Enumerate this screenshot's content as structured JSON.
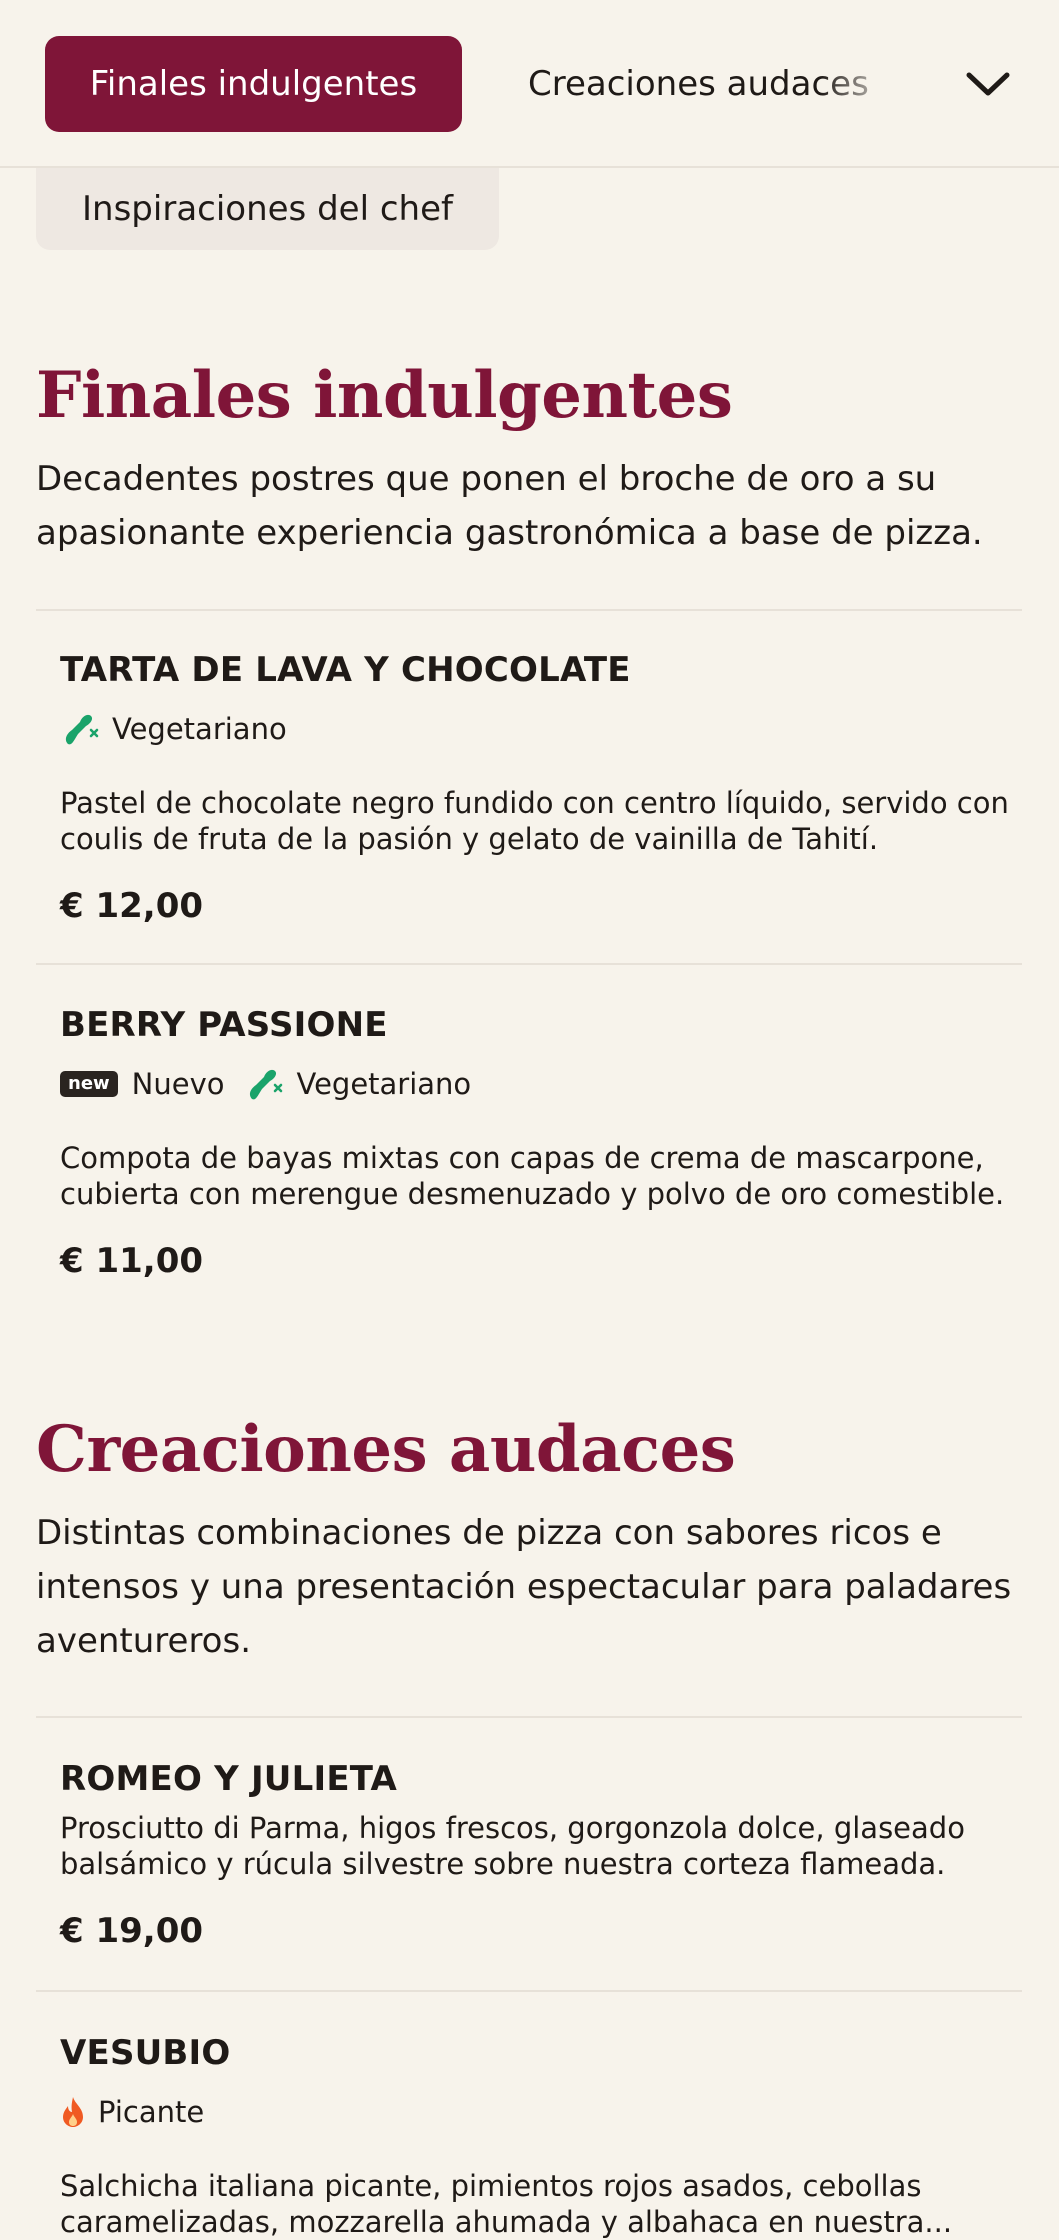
{
  "nav": {
    "tabs": [
      {
        "label": "Finales indulgentes",
        "active": true
      },
      {
        "label": "Creaciones audaces",
        "active": false
      },
      {
        "label": "Inspiraciones del chef",
        "active": false
      }
    ],
    "expand_icon": "chevron-down-icon"
  },
  "sections": [
    {
      "title": "Finales indulgentes",
      "description": "Decadentes postres que ponen el broche de oro a su apasionante experiencia gastronómica a base de pizza.",
      "items": [
        {
          "name": "TARTA DE LAVA Y CHOCOLATE",
          "tags": {
            "vegetarian": "Vegetariano"
          },
          "description": "Pastel de chocolate negro fundido con centro líquido, servido con coulis de fruta de la pasión y gelato de vainilla de Tahití.",
          "price": "€ 12,00"
        },
        {
          "name": "BERRY PASSIONE",
          "tags": {
            "new_badge": "new",
            "new": "Nuevo",
            "vegetarian": "Vegetariano"
          },
          "description": "Compota de bayas mixtas con capas de crema de mascarpone, cubierta con merengue desmenuzado y polvo de oro comestible.",
          "price": "€ 11,00"
        }
      ]
    },
    {
      "title": "Creaciones audaces",
      "description": "Distintas combinaciones de pizza con sabores ricos e intensos y una presentación espectacular para paladares aventureros.",
      "items": [
        {
          "name": "ROMEO Y JULIETA",
          "description": "Prosciutto di Parma, higos frescos, gorgonzola dolce, glaseado balsámico y rúcula silvestre sobre nuestra corteza flameada.",
          "price": "€ 19,00"
        },
        {
          "name": "VESUBIO",
          "tags": {
            "spicy": "Picante"
          },
          "description": "Salchicha italiana picante, pimientos rojos asados, cebollas caramelizadas, mozzarella ahumada y albahaca en nuestra..."
        }
      ]
    }
  ],
  "colors": {
    "accent": "#7f1538",
    "background": "#f7f3eb",
    "vegetarian_icon": "#1aa36a",
    "spicy_icon": "#f05a22"
  }
}
